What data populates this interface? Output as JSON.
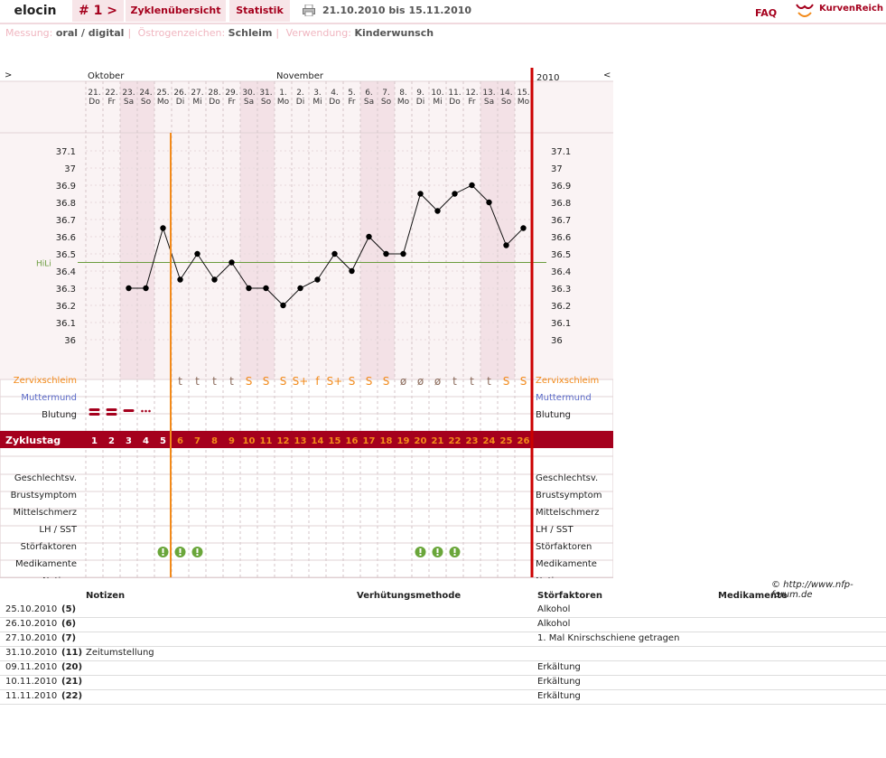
{
  "header": {
    "user": "elocin",
    "cycle": "# 1 >",
    "tabs": [
      "Zyklenübersicht",
      "Statistik"
    ],
    "date_range": "21.10.2010 bis 15.11.2010",
    "faq": "FAQ",
    "logo_text": "KurvenReich"
  },
  "meta": [
    {
      "label": "Messung:",
      "value": "oral / digital"
    },
    {
      "label": "Östrogenzeichen:",
      "value": "Schleim"
    },
    {
      "label": "Verwendung:",
      "value": "Kinderwunsch"
    }
  ],
  "chart": {
    "prev_arrow": ">",
    "next_arrow": "<",
    "months": [
      {
        "name": "Oktober",
        "col": 0
      },
      {
        "name": "November",
        "col": 11
      }
    ],
    "year": "2010",
    "days": [
      {
        "d": "21.",
        "w": "Do",
        "we": false
      },
      {
        "d": "22.",
        "w": "Fr",
        "we": false
      },
      {
        "d": "23.",
        "w": "Sa",
        "we": true
      },
      {
        "d": "24.",
        "w": "So",
        "we": true
      },
      {
        "d": "25.",
        "w": "Mo",
        "we": false
      },
      {
        "d": "26.",
        "w": "Di",
        "we": false
      },
      {
        "d": "27.",
        "w": "Mi",
        "we": false
      },
      {
        "d": "28.",
        "w": "Do",
        "we": false
      },
      {
        "d": "29.",
        "w": "Fr",
        "we": false
      },
      {
        "d": "30.",
        "w": "Sa",
        "we": true
      },
      {
        "d": "31.",
        "w": "So",
        "we": true
      },
      {
        "d": "1.",
        "w": "Mo",
        "we": false
      },
      {
        "d": "2.",
        "w": "Di",
        "we": false
      },
      {
        "d": "3.",
        "w": "Mi",
        "we": false
      },
      {
        "d": "4.",
        "w": "Do",
        "we": false
      },
      {
        "d": "5.",
        "w": "Fr",
        "we": false
      },
      {
        "d": "6.",
        "w": "Sa",
        "we": true
      },
      {
        "d": "7.",
        "w": "So",
        "we": true
      },
      {
        "d": "8.",
        "w": "Mo",
        "we": false
      },
      {
        "d": "9.",
        "w": "Di",
        "we": false
      },
      {
        "d": "10.",
        "w": "Mi",
        "we": false
      },
      {
        "d": "11.",
        "w": "Do",
        "we": false
      },
      {
        "d": "12.",
        "w": "Fr",
        "we": false
      },
      {
        "d": "13.",
        "w": "Sa",
        "we": true
      },
      {
        "d": "14.",
        "w": "So",
        "we": true
      },
      {
        "d": "15.",
        "w": "Mo",
        "we": false
      }
    ],
    "y_ticks": [
      "37.1",
      "37",
      "36.9",
      "36.8",
      "36.7",
      "36.6",
      "36.5",
      "36.4",
      "36.3",
      "36.2",
      "36.1",
      "36"
    ],
    "hili_label": "HiLi",
    "hili_value": 36.45,
    "temperatures": [
      null,
      null,
      36.3,
      36.3,
      36.65,
      36.35,
      36.5,
      36.35,
      36.45,
      36.3,
      36.3,
      36.2,
      36.3,
      36.35,
      36.5,
      36.4,
      36.6,
      36.5,
      36.5,
      36.85,
      36.75,
      36.85,
      36.9,
      36.8,
      36.55,
      36.65
    ],
    "cycle_day_label": "Zyklustag",
    "cycle_days": [
      "1",
      "2",
      "3",
      "4",
      "5",
      "6",
      "7",
      "8",
      "9",
      "10",
      "11",
      "12",
      "13",
      "14",
      "15",
      "16",
      "17",
      "18",
      "19",
      "20",
      "21",
      "22",
      "23",
      "24",
      "25",
      "26"
    ],
    "zervix_label": "Zervixschleim",
    "zervix": [
      "",
      "",
      "",
      "",
      "",
      "t",
      "t",
      "t",
      "t",
      "S",
      "S",
      "S",
      "S+",
      "f",
      "S+",
      "S",
      "S",
      "S",
      "ø",
      "ø",
      "ø",
      "t",
      "t",
      "t",
      "S",
      "S"
    ],
    "muttermund_label": "Muttermund",
    "blutung_label": "Blutung",
    "blutung": [
      3,
      3,
      2,
      1,
      0,
      0,
      0,
      0,
      0,
      0,
      0,
      0,
      0,
      0,
      0,
      0,
      0,
      0,
      0,
      0,
      0,
      0,
      0,
      0,
      0,
      0
    ],
    "rows": [
      "Geschlechtsv.",
      "Brustsymptom",
      "Mittelschmerz",
      "LH / SST",
      "Störfaktoren",
      "Medikamente",
      "Notizen"
    ],
    "stoer_days": [
      4,
      5,
      6,
      19,
      20,
      21
    ],
    "note_days": [
      10
    ],
    "colors": {
      "accent": "#a5001d",
      "orange": "#f28a1a",
      "blue": "#5b6bc8",
      "green_line": "#6b9c3f",
      "green_icon": "#6aa63a",
      "weekend": "#f3e1e6",
      "panel": "#faf3f4",
      "red_line": "#cc0000"
    }
  },
  "copyright": "© http://www.nfp-forum.de",
  "notes_table": {
    "headers": [
      "Notizen",
      "Verhütungsmethode",
      "Störfaktoren",
      "Medikamente"
    ],
    "rows": [
      {
        "date": "25.10.2010",
        "day": "(5)",
        "note": "",
        "stoer": "Alkohol"
      },
      {
        "date": "26.10.2010",
        "day": "(6)",
        "note": "",
        "stoer": "Alkohol"
      },
      {
        "date": "27.10.2010",
        "day": "(7)",
        "note": "",
        "stoer": "1. Mal Knirschschiene getragen"
      },
      {
        "date": "31.10.2010",
        "day": "(11)",
        "note": "Zeitumstellung",
        "stoer": ""
      },
      {
        "date": "09.11.2010",
        "day": "(20)",
        "note": "",
        "stoer": "Erkältung"
      },
      {
        "date": "10.11.2010",
        "day": "(21)",
        "note": "",
        "stoer": "Erkältung"
      },
      {
        "date": "11.11.2010",
        "day": "(22)",
        "note": "",
        "stoer": "Erkältung"
      }
    ]
  }
}
